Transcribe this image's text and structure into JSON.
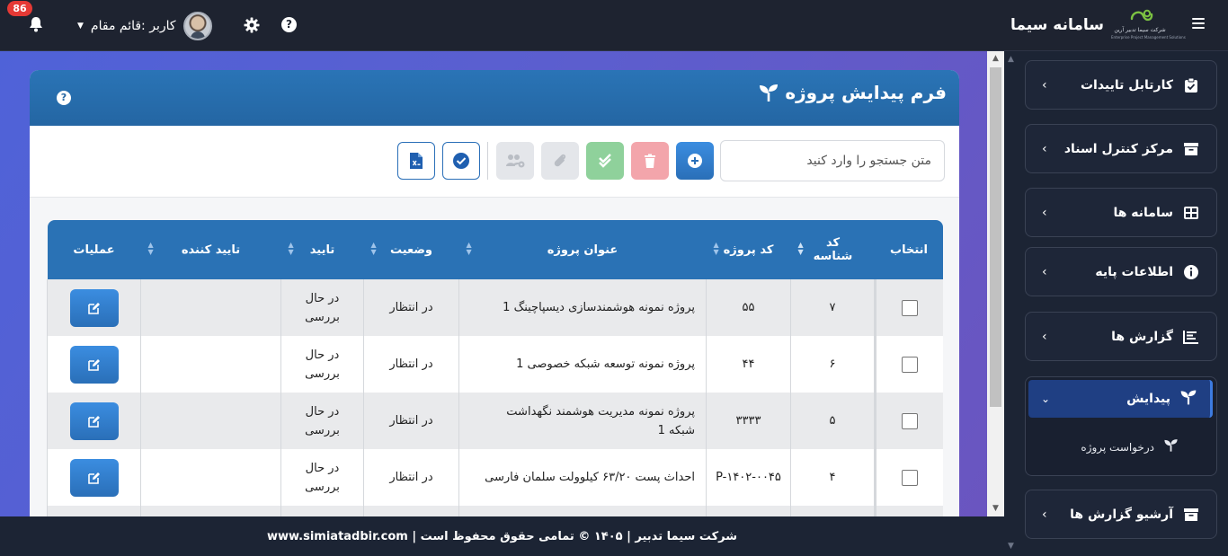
{
  "topbar": {
    "brand_title": "سامانه سیما",
    "brand_sub1": "شرکت سیما تدبیر آرین",
    "brand_sub2": "Enterprise Project Management Solutions",
    "notifications_count": "86",
    "user_label": "کاربر :قائم مقام",
    "help_label": "?"
  },
  "card": {
    "title": "فرم پیدایش پروژه",
    "help_label": "?"
  },
  "toolbar": {
    "search_placeholder": "متن جستجو را وارد کنید",
    "buttons": [
      "add-icon",
      "trash-icon",
      "double-check-icon",
      "paperclip-icon",
      "users-gear-icon",
      "check-circle-icon",
      "excel-file-icon"
    ]
  },
  "table": {
    "headers": {
      "select": "انتخاب",
      "id_line1": "کد",
      "id_line2": "شناسه",
      "code": "کد پروژه",
      "title": "عنوان پروژه",
      "state": "وضعیت",
      "approval": "تایید",
      "approver": "تایید کننده",
      "ops": "عملیات"
    },
    "rows": [
      {
        "id": "۷",
        "code": "۵۵",
        "title": "پروژه نمونه هوشمندسازی دیسپاچینگ 1",
        "state": "در انتظار",
        "approval_line1": "در حال",
        "approval_line2": "بررسی",
        "approver": ""
      },
      {
        "id": "۶",
        "code": "۴۴",
        "title": "پروژه نمونه توسعه شبکه خصوصی 1",
        "state": "در انتظار",
        "approval_line1": "در حال",
        "approval_line2": "بررسی",
        "approver": ""
      },
      {
        "id": "۵",
        "code": "۳۳۳۳",
        "title_line1": "پروژه نمونه مدیریت هوشمند نگهداشت",
        "title_line2": "شبکه 1",
        "state": "در انتظار",
        "approval_line1": "در حال",
        "approval_line2": "بررسی",
        "approver": ""
      },
      {
        "id": "۴",
        "code": "P-۱۴۰۲-۰۰۴۵",
        "title": "احداث پست ۶۳/۲۰ کیلوولت سلمان فارسی",
        "state": "در انتظار",
        "approval_line1": "در حال",
        "approval_line2": "بررسی",
        "approver": ""
      }
    ]
  },
  "sidebar": {
    "items": [
      {
        "label": "کارتابل تاییدات",
        "icon": "clipboard-check-icon"
      },
      {
        "label": "مرکز کنترل اسناد",
        "icon": "archive-box-icon"
      },
      {
        "label": "سامانه ها",
        "icon": "grid-icon"
      },
      {
        "label": "اطلاعات پایه",
        "icon": "info-circle-icon"
      },
      {
        "label": "گزارش ها",
        "icon": "bar-chart-icon"
      },
      {
        "label": "پیدایش",
        "icon": "seedling-icon",
        "expanded": true
      },
      {
        "label": "آرشیو گزارش ها",
        "icon": "archive-box-icon"
      }
    ],
    "sub_items": [
      {
        "label": "درخواست پروژه",
        "icon": "seedling-icon"
      }
    ]
  },
  "footer": {
    "text": "شرکت سیما تدبیر | ۱۴۰۵ © تمامی حقوق محفوظ است | www.simiatadbir.com"
  },
  "colors": {
    "primary": "#2a72b5",
    "topbar": "#1e2330",
    "sidebar": "#1c2434",
    "danger_soft": "#f3a5ab",
    "success_soft": "#8fd19b",
    "badge": "#e53935"
  }
}
